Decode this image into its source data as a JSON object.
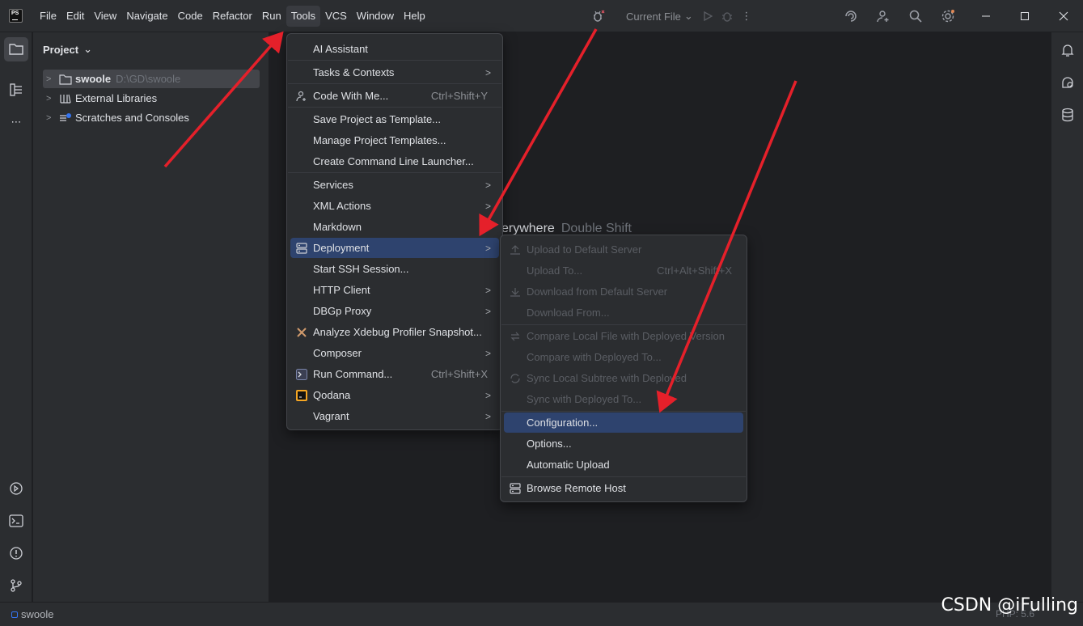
{
  "titlebar": {
    "menu": [
      "File",
      "Edit",
      "View",
      "Navigate",
      "Code",
      "Refactor",
      "Run",
      "Tools",
      "VCS",
      "Window",
      "Help"
    ],
    "active_menu": "Tools",
    "run_config": "Current File"
  },
  "project_panel": {
    "title": "Project",
    "tree": [
      {
        "label": "swoole",
        "path": "D:\\GD\\swoole",
        "icon": "folder-icon"
      },
      {
        "label": "External Libraries",
        "icon": "library-icon"
      },
      {
        "label": "Scratches and Consoles",
        "icon": "scratches-icon"
      }
    ]
  },
  "editor": {
    "hint_text": "erywhere",
    "hint_shortcut": "Double Shift"
  },
  "tools_menu": [
    {
      "label": "AI Assistant"
    },
    {
      "label": "Tasks & Contexts",
      "submenu": true
    },
    {
      "label": "Code With Me...",
      "shortcut": "Ctrl+Shift+Y",
      "icon": "code-with-me-icon"
    },
    {
      "label": "Save Project as Template..."
    },
    {
      "label": "Manage Project Templates..."
    },
    {
      "label": "Create Command Line Launcher..."
    },
    {
      "label": "Services",
      "submenu": true
    },
    {
      "label": "XML Actions",
      "submenu": true
    },
    {
      "label": "Markdown"
    },
    {
      "label": "Deployment",
      "submenu": true,
      "selected": true,
      "icon": "deployment-icon"
    },
    {
      "label": "Start SSH Session..."
    },
    {
      "label": "HTTP Client",
      "submenu": true
    },
    {
      "label": "DBGp Proxy",
      "submenu": true
    },
    {
      "label": "Analyze Xdebug Profiler Snapshot...",
      "icon": "xdebug-icon"
    },
    {
      "label": "Composer",
      "submenu": true
    },
    {
      "label": "Run Command...",
      "shortcut": "Ctrl+Shift+X",
      "icon": "terminal-icon"
    },
    {
      "label": "Qodana",
      "submenu": true,
      "icon": "qodana-icon"
    },
    {
      "label": "Vagrant",
      "submenu": true
    }
  ],
  "deployment_menu": [
    {
      "label": "Upload to Default Server",
      "disabled": true,
      "icon": "upload-icon"
    },
    {
      "label": "Upload To...",
      "shortcut": "Ctrl+Alt+Shift+X",
      "disabled": true
    },
    {
      "label": "Download from Default Server",
      "disabled": true,
      "icon": "download-icon"
    },
    {
      "label": "Download From...",
      "disabled": true
    },
    {
      "label": "Compare Local File with Deployed Version",
      "disabled": true,
      "icon": "compare-icon"
    },
    {
      "label": "Compare with Deployed To...",
      "disabled": true
    },
    {
      "label": "Sync Local Subtree with Deployed",
      "disabled": true,
      "icon": "sync-icon"
    },
    {
      "label": "Sync with Deployed To...",
      "disabled": true
    },
    {
      "label": "Configuration...",
      "selected": true
    },
    {
      "label": "Options..."
    },
    {
      "label": "Automatic Upload"
    },
    {
      "label": "Browse Remote Host",
      "icon": "remote-host-icon"
    }
  ],
  "statusbar": {
    "project": "swoole",
    "right_text": "PHP: 5.6"
  },
  "watermark": "CSDN @iFulling",
  "colors": {
    "selection": "#2e436e",
    "annotation_arrow": "#e5202a"
  }
}
